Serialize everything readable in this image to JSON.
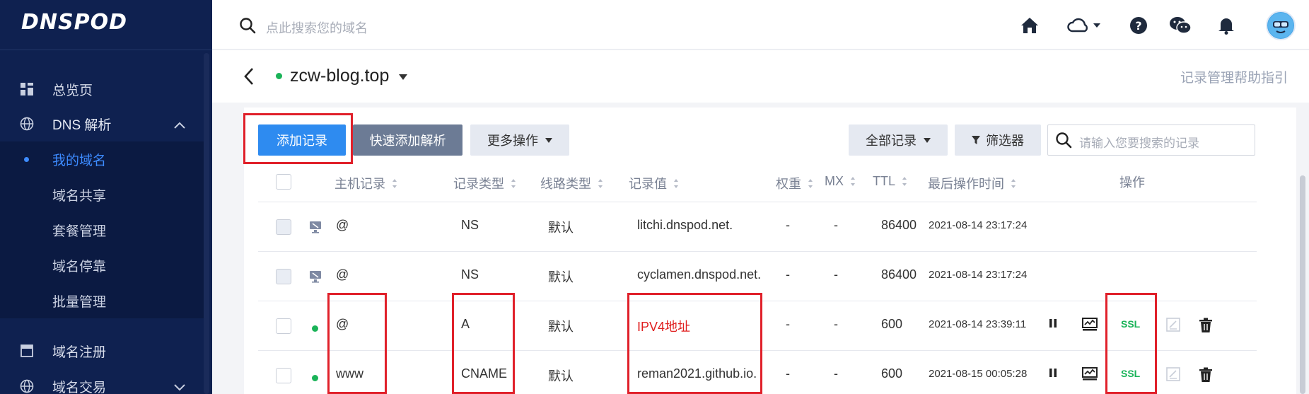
{
  "sidebar": {
    "logo": "DNSPOD",
    "items": [
      {
        "label": "总览页",
        "icon": "dashboard-icon"
      },
      {
        "label": "DNS 解析",
        "icon": "globe-icon"
      },
      {
        "label": "域名注册",
        "icon": "window-icon"
      },
      {
        "label": "域名交易",
        "icon": "globe-icon"
      }
    ],
    "sub_items": [
      {
        "label": "我的域名",
        "active": true
      },
      {
        "label": "域名共享"
      },
      {
        "label": "套餐管理"
      },
      {
        "label": "域名停靠"
      },
      {
        "label": "批量管理"
      }
    ]
  },
  "header": {
    "search_placeholder": "点此搜索您的域名",
    "icons": [
      "home-icon",
      "cloud-icon",
      "help-icon",
      "wechat-icon",
      "bell-icon",
      "avatar"
    ]
  },
  "subheader": {
    "domain": "zcw-blog.top",
    "help_link": "记录管理帮助指引"
  },
  "toolbar": {
    "add_record": "添加记录",
    "quick_add": "快速添加解析",
    "more_actions": "更多操作",
    "all_records": "全部记录",
    "filter": "筛选器",
    "search_placeholder": "请输入您要搜索的记录"
  },
  "table": {
    "headers": {
      "host": "主机记录",
      "type": "记录类型",
      "line": "线路类型",
      "value": "记录值",
      "weight": "权重",
      "mx": "MX",
      "ttl": "TTL",
      "time": "最后操作时间",
      "actions": "操作"
    },
    "rows": [
      {
        "host": "@",
        "type": "NS",
        "line": "默认",
        "value": "litchi.dnspod.net.",
        "weight": "-",
        "mx": "-",
        "ttl": "86400",
        "time": "2021-08-14 23:17:24",
        "system": true
      },
      {
        "host": "@",
        "type": "NS",
        "line": "默认",
        "value": "cyclamen.dnspod.net.",
        "weight": "-",
        "mx": "-",
        "ttl": "86400",
        "time": "2021-08-14 23:17:24",
        "system": true
      },
      {
        "host": "@",
        "type": "A",
        "line": "默认",
        "value": "IPV4地址",
        "weight": "-",
        "mx": "-",
        "ttl": "600",
        "time": "2021-08-14 23:39:11",
        "system": false,
        "ssl": "SSL"
      },
      {
        "host": "www",
        "type": "CNAME",
        "line": "默认",
        "value": "reman2021.github.io.",
        "weight": "-",
        "mx": "-",
        "ttl": "600",
        "time": "2021-08-15 00:05:28",
        "system": false,
        "ssl": "SSL"
      }
    ]
  },
  "colors": {
    "sidebar_bg": "#0f2150",
    "primary": "#2e8bf0",
    "active_blue": "#3d8bff",
    "highlight_red": "#e0202a",
    "status_green": "#1ab358"
  }
}
